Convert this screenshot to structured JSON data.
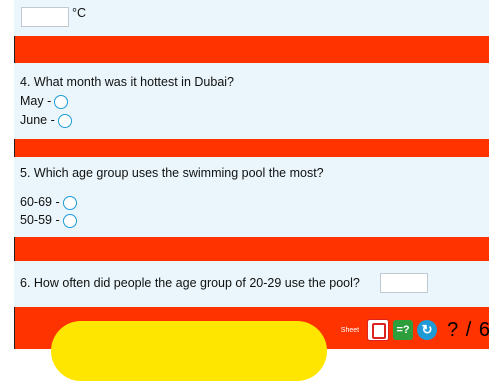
{
  "q3": {
    "unit": "°C"
  },
  "q4": {
    "question": "4. What month was it hottest in Dubai?",
    "options": [
      "May -",
      "June -"
    ]
  },
  "q5": {
    "question": "5. Which age group uses the swimming pool the most?",
    "options": [
      "60-69 -",
      "50-59 -"
    ]
  },
  "q6": {
    "question": "6. How often did people the age group of 20-29 use the pool?"
  },
  "footer": {
    "sheet_label": "Sheet",
    "eq_label": "=?",
    "reload_label": "↻",
    "score": "? / 6"
  },
  "colors": {
    "accent": "#ff3300",
    "question_bg": "#eaf6fb",
    "radio": "#1e9bd7",
    "button_yellow": "#ffe600"
  }
}
